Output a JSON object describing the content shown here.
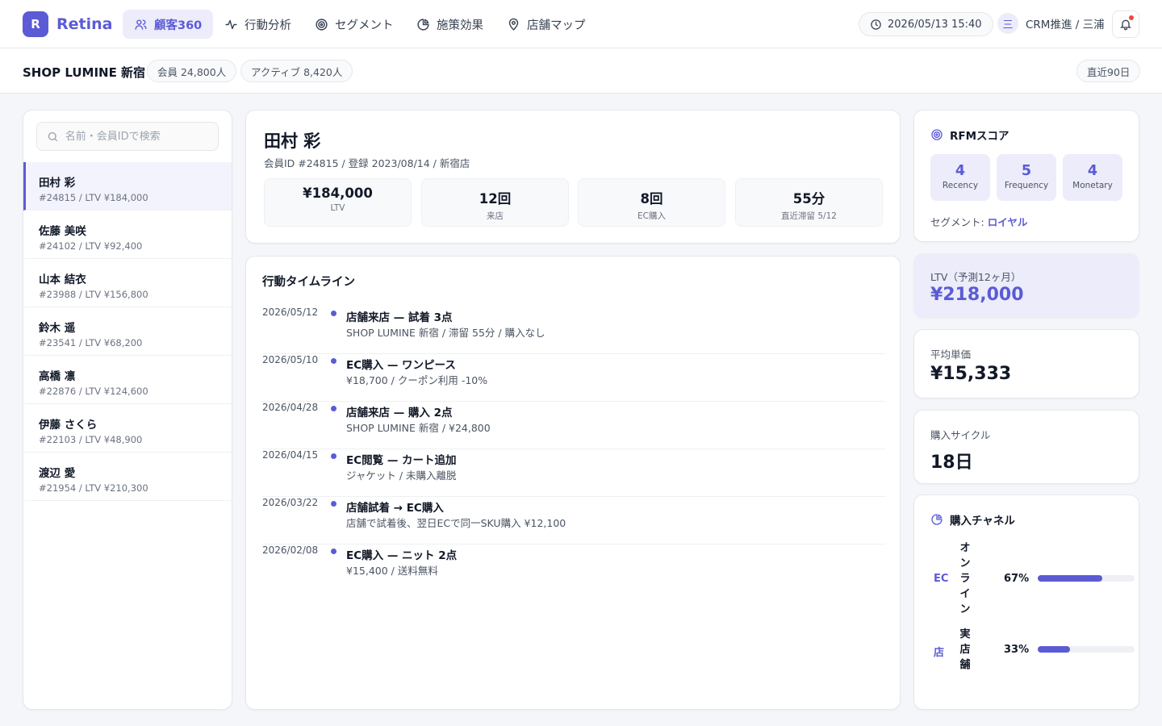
{
  "app": {
    "logo_letter": "R",
    "name": "Retina"
  },
  "nav": {
    "tabs": [
      {
        "label": "顧客360",
        "icon": "users-icon",
        "active": true
      },
      {
        "label": "行動分析",
        "icon": "activity-icon"
      },
      {
        "label": "セグメント",
        "icon": "target-icon"
      },
      {
        "label": "施策効果",
        "icon": "pie-chart-icon"
      },
      {
        "label": "店舗マップ",
        "icon": "map-pin-icon"
      }
    ]
  },
  "header": {
    "datetime": "2026/05/13 15:40",
    "user_initial": "三",
    "user": "CRM推進 / 三浦"
  },
  "subbar": {
    "shop": "SHOP LUMINE 新宿",
    "members": "会員 24,800人",
    "active": "アクティブ 8,420人",
    "period": "直近90日"
  },
  "search": {
    "placeholder": "名前・会員IDで検索"
  },
  "customers": [
    {
      "name": "田村 彩",
      "sub": "#24815 / LTV ¥184,000",
      "active": true
    },
    {
      "name": "佐藤 美咲",
      "sub": "#24102 / LTV ¥92,400"
    },
    {
      "name": "山本 結衣",
      "sub": "#23988 / LTV ¥156,800"
    },
    {
      "name": "鈴木 遥",
      "sub": "#23541 / LTV ¥68,200"
    },
    {
      "name": "高橋 凛",
      "sub": "#22876 / LTV ¥124,600"
    },
    {
      "name": "伊藤 さくら",
      "sub": "#22103 / LTV ¥48,900"
    },
    {
      "name": "渡辺 愛",
      "sub": "#21954 / LTV ¥210,300"
    }
  ],
  "profile": {
    "name": "田村 彩",
    "meta": "会員ID #24815 / 登録 2023/08/14 / 新宿店",
    "stats": [
      {
        "value": "¥184,000",
        "label": "LTV"
      },
      {
        "value": "12回",
        "label": "来店"
      },
      {
        "value": "8回",
        "label": "EC購入"
      },
      {
        "value": "55分",
        "label": "直近滞留 5/12"
      }
    ]
  },
  "timeline": {
    "title": "行動タイムライン",
    "items": [
      {
        "date": "2026/05/12",
        "title": "店舗来店 — 試着 3点",
        "desc": "SHOP LUMINE 新宿 / 滞留 55分 / 購入なし"
      },
      {
        "date": "2026/05/10",
        "title": "EC購入 — ワンピース",
        "desc": "¥18,700 / クーポン利用 -10%"
      },
      {
        "date": "2026/04/28",
        "title": "店舗来店 — 購入 2点",
        "desc": "SHOP LUMINE 新宿 / ¥24,800"
      },
      {
        "date": "2026/04/15",
        "title": "EC閲覧 — カート追加",
        "desc": "ジャケット / 未購入離脱"
      },
      {
        "date": "2026/03/22",
        "title": "店舗試着 → EC購入",
        "desc": "店舗で試着後、翌日ECで同一SKU購入 ¥12,100"
      },
      {
        "date": "2026/02/08",
        "title": "EC購入 — ニット 2点",
        "desc": "¥15,400 / 送料無料"
      }
    ]
  },
  "rfm": {
    "title": "RFMスコア",
    "scores": [
      {
        "value": "4",
        "label": "Recency"
      },
      {
        "value": "5",
        "label": "Frequency"
      },
      {
        "value": "4",
        "label": "Monetary"
      }
    ],
    "segment_label": "セグメント: ",
    "segment": "ロイヤル"
  },
  "ltv_forecast": {
    "label": "LTV（予測12ヶ月）",
    "value": "¥218,000"
  },
  "avg_price": {
    "label": "平均単価",
    "value": "¥15,333"
  },
  "cycle": {
    "label": "購入サイクル",
    "value": "18日"
  },
  "channels": {
    "title": "購入チャネル",
    "items": [
      {
        "code": "EC",
        "name": "オンライン",
        "pct_label": "67%",
        "share": 0.67
      },
      {
        "code": "店",
        "name": "実店舗",
        "pct_label": "33%",
        "share": 0.33
      }
    ]
  },
  "colors": {
    "accent": "#5b5bd6",
    "accent_soft": "#ececfb",
    "alert": "#ef4444"
  }
}
